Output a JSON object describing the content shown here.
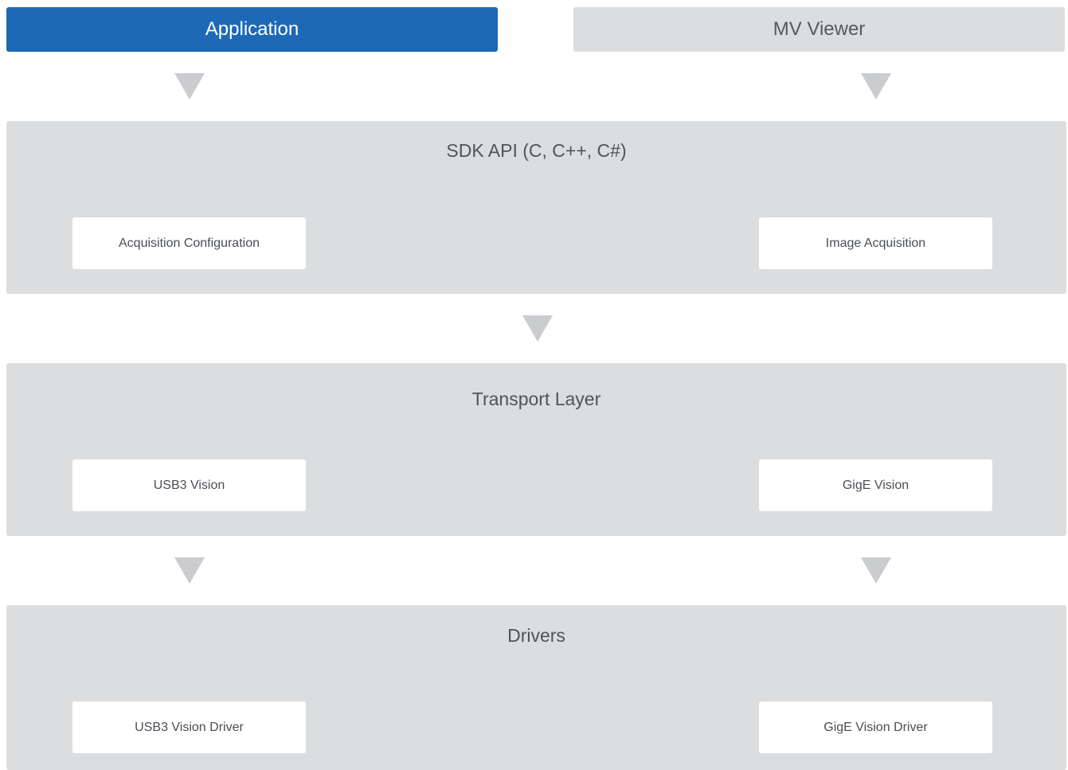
{
  "top_row": {
    "application": "Application",
    "mv_viewer": "MV Viewer"
  },
  "colors": {
    "primary": "#1e69b5",
    "layer_background": "#dcdddf",
    "arrow": "#cbcccf",
    "module_background": "#ffffff"
  },
  "layers": {
    "sdk": {
      "title": "SDK API (C, C++, C#)",
      "left_module": "Acquisition Configuration",
      "right_module": "Image Acquisition"
    },
    "transport": {
      "title": "Transport Layer",
      "left_module": "USB3 Vision",
      "right_module": "GigE Vision"
    },
    "drivers": {
      "title": "Drivers",
      "left_module": "USB3 Vision Driver",
      "right_module": "GigE Vision Driver"
    }
  }
}
